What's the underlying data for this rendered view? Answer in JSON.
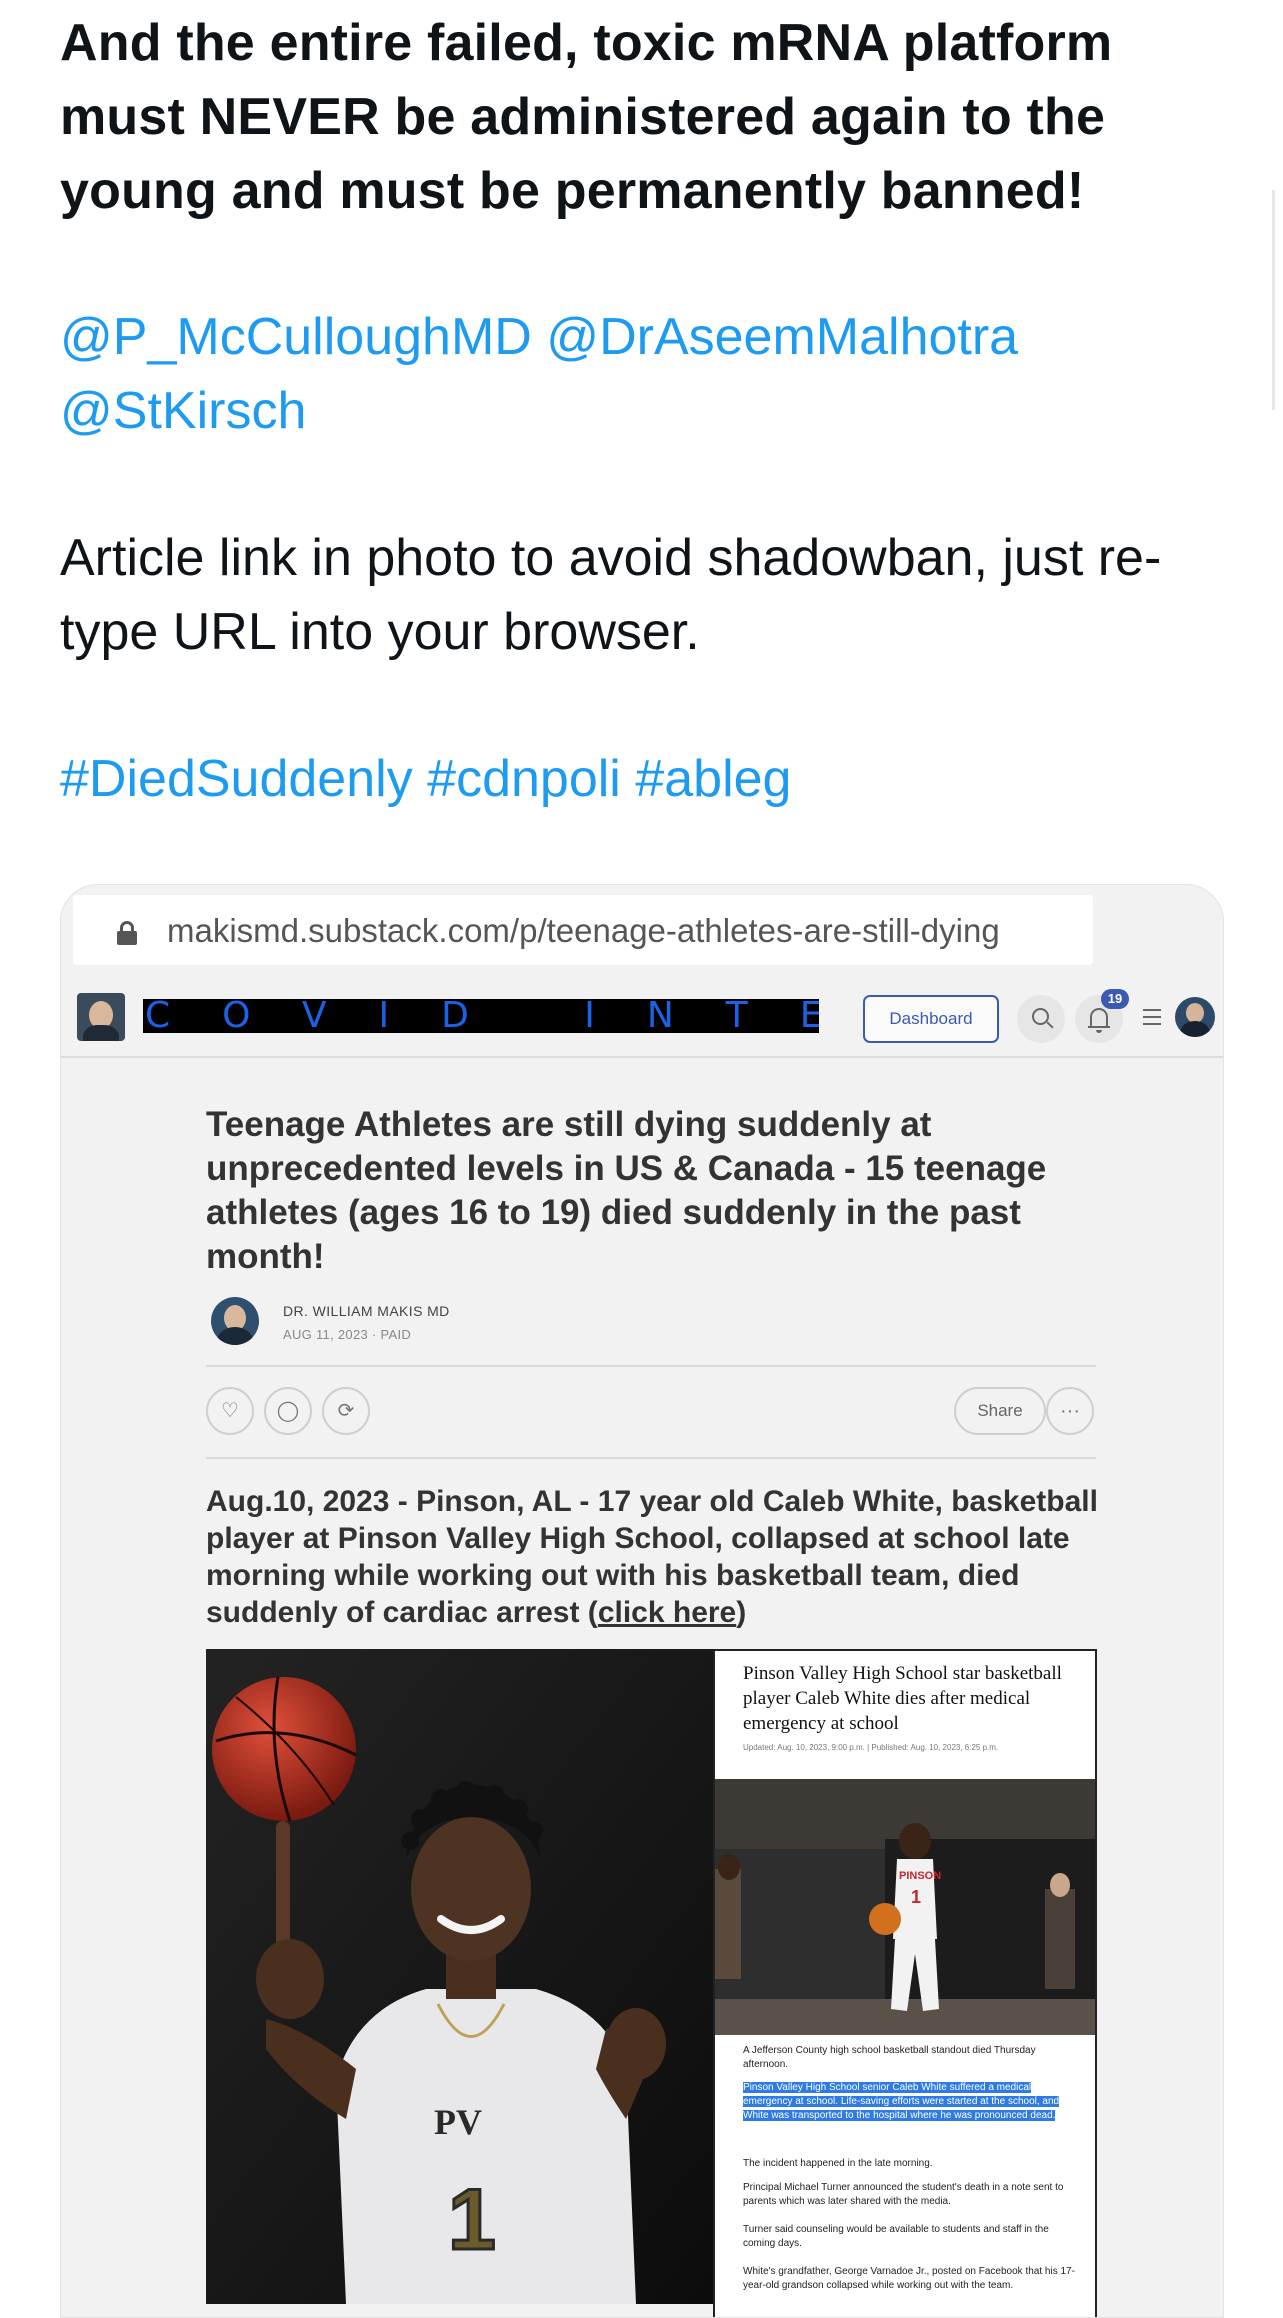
{
  "tweet": {
    "paragraph1": "And the entire failed, toxic mRNA platform must NEVER be administered again to the young and must be permanently banned!",
    "mentions": [
      "@P_McCulloughMD",
      "@DrAseemMalhotra",
      "@StKirsch"
    ],
    "paragraph3": "Article link in photo to avoid shadowban, just re-type URL into your browser.",
    "hashtags": [
      "#DiedSuddenly",
      "#cdnpoli",
      "#ableg"
    ]
  },
  "screenshot": {
    "url": "makismd.substack.com/p/teenage-athletes-are-still-dying",
    "site_title": "COVID INTEL",
    "dashboard_label": "Dashboard",
    "notification_count": "19",
    "article_title": "Teenage Athletes are still dying suddenly at unprecedented levels in US & Canada - 15 teenage athletes (ages 16 to 19) died suddenly in the past month!",
    "author": "DR. WILLIAM MAKIS MD",
    "meta": "AUG 11, 2023 · PAID",
    "share_label": "Share",
    "more_label": "···",
    "body_text": "Aug.10, 2023 - Pinson, AL - 17 year old Caleb White, basketball player at Pinson Valley High School, collapsed at school late morning while working out with his basketball team, died suddenly of cardiac arrest (",
    "body_link": "click here",
    "body_close": ")",
    "clipping": {
      "headline": "Pinson Valley High School star basketball player Caleb White dies after medical emergency at school",
      "dateline": "Updated: Aug. 10, 2023, 9:00 p.m. | Published: Aug. 10, 2023, 6:25 p.m.",
      "jersey_text": "PINSON",
      "jersey_number": "1",
      "p1": "A Jefferson County high school basketball standout died Thursday afternoon.",
      "p2": "Pinson Valley High School senior Caleb White suffered a medical emergency at school. Life-saving efforts were started at the school, and White was transported to the hospital where he was pronounced dead.",
      "p3": "The incident happened in the late morning.",
      "p4": "Principal Michael Turner announced the student's death in a note sent to parents which was later shared with the media.",
      "p5": "Turner said counseling would be available to students and staff in the coming days.",
      "p6": "White's grandfather, George Varnadoe Jr., posted on Facebook that his 17-year-old grandson collapsed while working out with the team."
    },
    "photo": {
      "jersey_logo": "PV",
      "jersey_number": "1"
    }
  }
}
